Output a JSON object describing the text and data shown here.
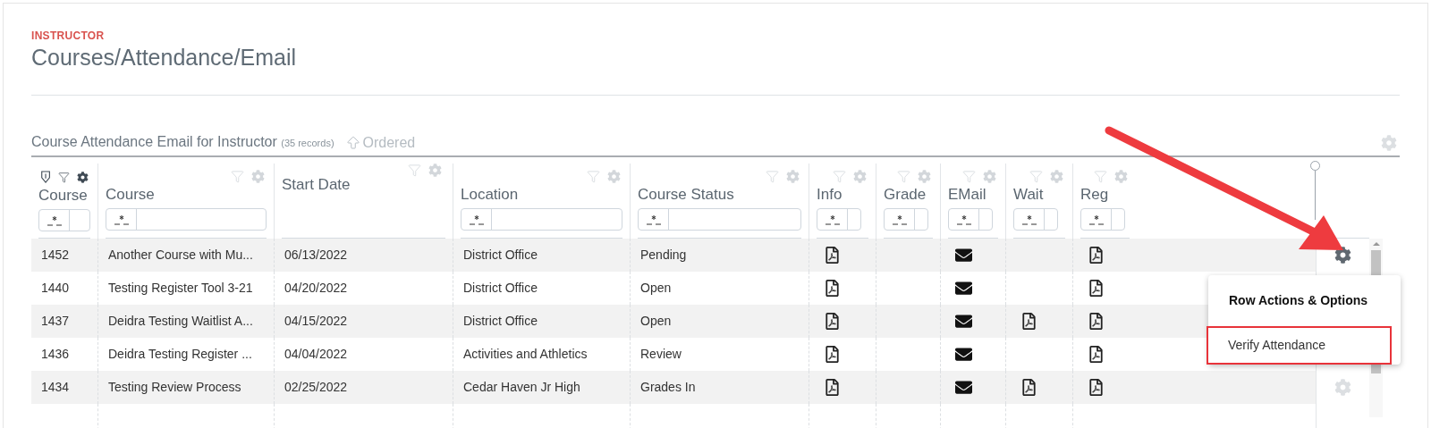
{
  "header": {
    "role": "INSTRUCTOR",
    "title": "Courses/Attendance/Email"
  },
  "grid": {
    "title": "Course Attendance Email for Instructor",
    "count": "(35 records)",
    "order_label": "Ordered",
    "columns": [
      {
        "label": "Course",
        "kind": "text",
        "filterable": true,
        "active": true,
        "sorted": true
      },
      {
        "label": "Course",
        "kind": "text",
        "filterable": true,
        "active": false,
        "sorted": false
      },
      {
        "label": "Start Date",
        "kind": "text",
        "filterable": false,
        "active": false,
        "sorted": false
      },
      {
        "label": "Location",
        "kind": "text",
        "filterable": true,
        "active": false,
        "sorted": false
      },
      {
        "label": "Course Status",
        "kind": "text",
        "filterable": true,
        "active": false,
        "sorted": false
      },
      {
        "label": "Info",
        "kind": "document",
        "filterable": true,
        "active": false,
        "sorted": false
      },
      {
        "label": "Grade",
        "kind": "document",
        "filterable": true,
        "active": false,
        "sorted": false
      },
      {
        "label": "EMail",
        "kind": "email",
        "filterable": true,
        "active": false,
        "sorted": false
      },
      {
        "label": "Wait",
        "kind": "document",
        "filterable": true,
        "active": false,
        "sorted": false
      },
      {
        "label": "Reg",
        "kind": "document",
        "filterable": true,
        "active": false,
        "sorted": false
      }
    ],
    "rows": [
      {
        "cells": [
          "1452",
          "Another Course with Mu...",
          "06/13/2022",
          "District Office",
          "Pending",
          true,
          false,
          true,
          false,
          true
        ],
        "menu_open": true,
        "gear_visible": true
      },
      {
        "cells": [
          "1440",
          "Testing Register Tool 3-21",
          "04/20/2022",
          "District Office",
          "Open",
          true,
          false,
          true,
          false,
          true
        ],
        "gear_visible": false
      },
      {
        "cells": [
          "1437",
          "Deidra Testing Waitlist A...",
          "04/15/2022",
          "District Office",
          "Open",
          true,
          false,
          true,
          true,
          true
        ],
        "gear_visible": false
      },
      {
        "cells": [
          "1436",
          "Deidra Testing Register ...",
          "04/04/2022",
          "Activities and Athletics",
          "Review",
          true,
          false,
          true,
          false,
          true
        ],
        "gear_visible": false
      },
      {
        "cells": [
          "1434",
          "Testing Review Process",
          "02/25/2022",
          "Cedar Haven Jr High",
          "Grades In",
          true,
          false,
          true,
          true,
          true
        ],
        "menu_open": false,
        "gear_visible": true
      }
    ],
    "menu": {
      "title": "Row Actions & Options",
      "items": [
        {
          "label": "Verify Attendance",
          "highlighted": true
        }
      ]
    }
  }
}
